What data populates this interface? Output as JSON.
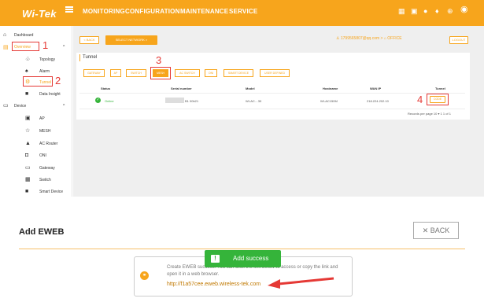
{
  "topbar": {
    "logo": "Wi-Tek",
    "nav": [
      "MONITORING",
      "CONFIGURATION",
      "MAINTENANCE",
      "SERVICE"
    ]
  },
  "sidebar": {
    "dashboard": "Dashboard",
    "overview": "Overview",
    "items": [
      "Topology",
      "Alarm",
      "Tunnel",
      "Data Insight"
    ],
    "device": "Device",
    "device_items": [
      "AP",
      "MESH",
      "AC Router",
      "ONI",
      "Gateway",
      "Switch",
      "Smart Device"
    ]
  },
  "toolbar": {
    "back": "< BACK",
    "network": "SELECT NETWORK",
    "user": "1799565807@qq.com",
    "office": "OFFICE",
    "logout": "LOGOUT"
  },
  "panel": {
    "title": "Tunnel",
    "tabs": [
      "GATEWAY",
      "AP",
      "SWITCH",
      "MESH",
      "AC SWITCH",
      "ONI",
      "SMART DEVICE",
      "USER DEFINED"
    ],
    "columns": [
      "Status",
      "Serial number",
      "Model",
      "Hostname",
      "WAN IP",
      "Tunnel"
    ],
    "row": {
      "status": "Online",
      "serial": "B1 00b21",
      "model": "WI-AC…30",
      "hostname": "WI-AC150M",
      "wan_ip": "218.224.202.10",
      "tunnel": "CODE"
    },
    "pagination": "Records per page  10  ▾   1 1 of 1"
  },
  "annotations": [
    "1",
    "2",
    "3",
    "4"
  ],
  "bottom": {
    "title": "Add EWEB",
    "back": "BACK",
    "toast": "Add success",
    "text": "Create EWEB success! You can click the link below to access or copy the link and open it in a web browser.",
    "link": "http://f1a57cee.eweb.wireless-tek.com"
  }
}
